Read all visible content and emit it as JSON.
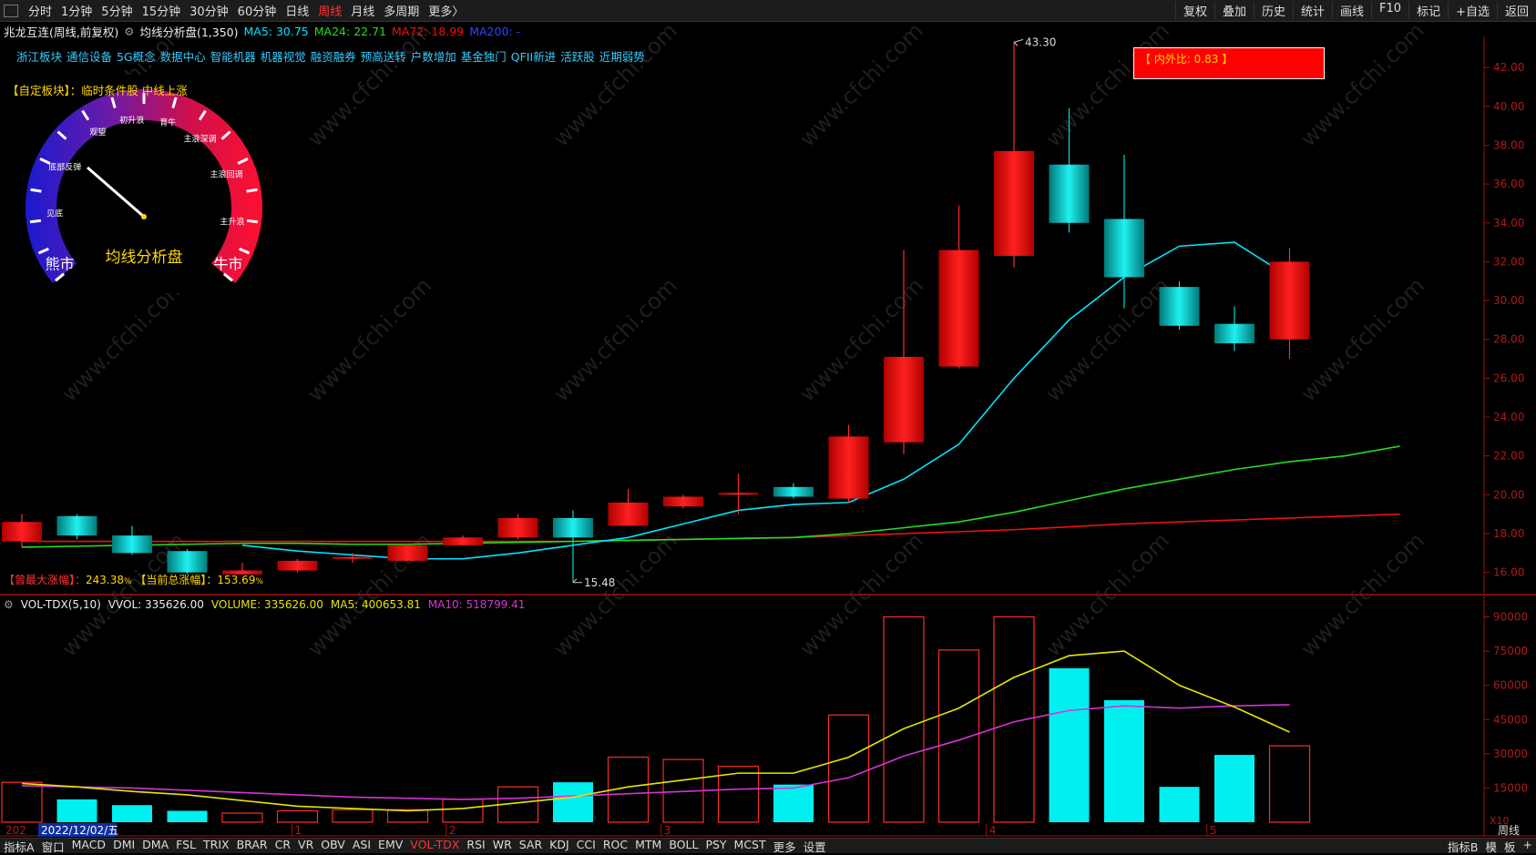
{
  "topbar": {
    "periods": [
      "分时",
      "1分钟",
      "5分钟",
      "15分钟",
      "30分钟",
      "60分钟",
      "日线",
      "周线",
      "月线",
      "多周期",
      "更多〉"
    ],
    "active_period": "周线",
    "right_buttons": [
      "复权",
      "叠加",
      "历史",
      "统计",
      "画线",
      "F10",
      "标记",
      "+自选",
      "返回"
    ]
  },
  "info": {
    "stock": "兆龙互连(周线,前复权)",
    "indicator": "均线分析盘(1,350)",
    "ma5": "MA5: 30.75",
    "ma24": "MA24: 22.71",
    "ma72": "MA72: 18.99",
    "ma200": "MA200: -"
  },
  "blocks": [
    "浙江板块",
    "通信设备",
    "5G概念",
    "数据中心",
    "智能机器",
    "机器视觉",
    "融资融券",
    "预高送转",
    "户数增加",
    "基金独门",
    "QFII新进",
    "活跃股",
    "近期弱势"
  ],
  "custom_block": {
    "label": "【自定板块】：",
    "value": "临时条件股 中线上涨"
  },
  "gauge": {
    "title": "均线分析盘",
    "labels": [
      "熊市",
      "见底",
      "底部反弹",
      "观望",
      "初升浪",
      "育牛",
      "主浪深调",
      "主浪回调",
      "主升浪",
      "牛市"
    ]
  },
  "ratio_box": {
    "label": "【 内外比: 0.83 】"
  },
  "stats": {
    "max_rise_label": "【曾最大涨幅】：",
    "max_rise": "243.38",
    "pct": "%",
    "current_rise_label": "【当前总涨幅】：",
    "current_rise": "153.69"
  },
  "markers": {
    "high": "43.30",
    "low": "15.48"
  },
  "volume_info": {
    "name": "VOL-TDX(5,10)",
    "vvol": "VVOL: 335626.00",
    "volume": "VOLUME: 335626.00",
    "ma5": "MA5: 400653.81",
    "ma10": "MA10: 518799.41"
  },
  "x_axis": {
    "date": "2022/12/02/五",
    "prefix": "202",
    "month_marks": [
      "1",
      "2",
      "3",
      "4",
      "5"
    ]
  },
  "price_axis": [
    "42.00",
    "40.00",
    "38.00",
    "36.00",
    "34.00",
    "32.00",
    "30.00",
    "28.00",
    "26.00",
    "24.00",
    "22.00",
    "20.00",
    "18.00",
    "16.00"
  ],
  "vol_axis": [
    "90000",
    "75000",
    "60000",
    "45000",
    "30000",
    "15000"
  ],
  "vol_unit": "X10",
  "period_corner": "周线",
  "bottombar": {
    "left": [
      "指标A",
      "窗口"
    ],
    "indicators": [
      "MACD",
      "DMI",
      "DMA",
      "FSL",
      "TRIX",
      "BRAR",
      "CR",
      "VR",
      "OBV",
      "ASI",
      "EMV",
      "VOL-TDX",
      "RSI",
      "WR",
      "SAR",
      "KDJ",
      "CCI",
      "ROC",
      "MTM",
      "BOLL",
      "PSY",
      "MCST",
      "更多",
      "设置"
    ],
    "active": "VOL-TDX",
    "right": [
      "指标B",
      "模",
      "板",
      "+"
    ]
  },
  "watermark": "www.cfchi.com",
  "colors": {
    "up": "#ff1a1a",
    "down": "#00e5e5",
    "ma5": "#00e5ff",
    "ma24": "#22dd22",
    "ma72": "#ee1111",
    "vol_ma5": "#e6e600",
    "vol_ma10": "#d633d6"
  },
  "chart_data": {
    "type": "candlestick",
    "price_range": [
      15,
      43.6
    ],
    "candles": [
      {
        "o": 17.6,
        "c": 18.6,
        "h": 19.0,
        "l": 17.3
      },
      {
        "o": 18.9,
        "c": 17.9,
        "h": 19.0,
        "l": 17.7
      },
      {
        "o": 17.9,
        "c": 17.0,
        "h": 18.4,
        "l": 16.9
      },
      {
        "o": 17.1,
        "c": 16.0,
        "h": 17.2,
        "l": 15.9
      },
      {
        "o": 15.9,
        "c": 16.1,
        "h": 16.5,
        "l": 15.9
      },
      {
        "o": 16.1,
        "c": 16.6,
        "h": 16.7,
        "l": 16.0
      },
      {
        "o": 16.7,
        "c": 16.8,
        "h": 17.0,
        "l": 16.5
      },
      {
        "o": 16.6,
        "c": 17.4,
        "h": 17.5,
        "l": 16.6
      },
      {
        "o": 17.4,
        "c": 17.8,
        "h": 17.9,
        "l": 17.4
      },
      {
        "o": 17.8,
        "c": 18.8,
        "h": 19.0,
        "l": 17.7
      },
      {
        "o": 18.8,
        "c": 17.8,
        "h": 19.2,
        "l": 15.5
      },
      {
        "o": 18.4,
        "c": 19.6,
        "h": 20.3,
        "l": 18.4
      },
      {
        "o": 19.4,
        "c": 19.9,
        "h": 20.0,
        "l": 19.3
      },
      {
        "o": 20.0,
        "c": 20.1,
        "h": 21.1,
        "l": 19.0
      },
      {
        "o": 20.4,
        "c": 19.9,
        "h": 20.6,
        "l": 19.8
      },
      {
        "o": 19.8,
        "c": 23.0,
        "h": 23.6,
        "l": 19.6
      },
      {
        "o": 22.7,
        "c": 27.1,
        "h": 32.6,
        "l": 22.1
      },
      {
        "o": 26.6,
        "c": 32.6,
        "h": 34.9,
        "l": 26.5
      },
      {
        "o": 32.3,
        "c": 37.7,
        "h": 43.3,
        "l": 31.7
      },
      {
        "o": 37.0,
        "c": 34.0,
        "h": 39.9,
        "l": 33.5
      },
      {
        "o": 34.2,
        "c": 31.2,
        "h": 37.5,
        "l": 29.6
      },
      {
        "o": 30.7,
        "c": 28.7,
        "h": 31.0,
        "l": 28.5
      },
      {
        "o": 28.8,
        "c": 27.8,
        "h": 29.7,
        "l": 27.4
      },
      {
        "o": 28.0,
        "c": 32.0,
        "h": 32.7,
        "l": 27.0
      }
    ],
    "ma5": [
      null,
      null,
      null,
      null,
      17.4,
      17.1,
      16.9,
      16.7,
      16.7,
      17.0,
      17.4,
      17.8,
      18.5,
      19.2,
      19.5,
      19.6,
      20.8,
      22.6,
      26.0,
      29.0,
      31.2,
      32.8,
      33.0,
      31.2
    ],
    "ma24": [
      17.3,
      17.35,
      17.4,
      17.45,
      17.5,
      17.5,
      17.45,
      17.45,
      17.5,
      17.55,
      17.6,
      17.65,
      17.7,
      17.75,
      17.8,
      18.0,
      18.3,
      18.6,
      19.1,
      19.7,
      20.3,
      20.8,
      21.3,
      21.7,
      22.0,
      22.5
    ],
    "ma72": [
      17.6,
      17.6,
      17.6,
      17.6,
      17.6,
      17.6,
      17.6,
      17.6,
      17.6,
      17.6,
      17.6,
      17.65,
      17.7,
      17.75,
      17.8,
      17.9,
      18.0,
      18.1,
      18.2,
      18.35,
      18.5,
      18.6,
      18.7,
      18.8,
      18.9,
      19.0
    ],
    "volume_range": [
      0,
      91000
    ],
    "volumes": [
      17500,
      10000,
      7500,
      5000,
      4000,
      5000,
      5500,
      5500,
      10000,
      15500,
      17500,
      28500,
      27500,
      24500,
      16500,
      47000,
      90000,
      75500,
      90000,
      67500,
      53500,
      15500,
      29500,
      33500
    ],
    "vol_ma5": [
      17000,
      15500,
      13500,
      12000,
      9500,
      7000,
      6000,
      5000,
      6000,
      8500,
      11000,
      15500,
      18500,
      21500,
      21500,
      28500,
      41000,
      50000,
      63500,
      73000,
      75000,
      60000,
      50500,
      39500
    ],
    "vol_ma10": [
      16000,
      15500,
      15000,
      14000,
      13000,
      12000,
      11000,
      10500,
      10000,
      10500,
      11500,
      12500,
      13500,
      14500,
      15000,
      19500,
      29000,
      36000,
      44000,
      49000,
      51000,
      50000,
      51000,
      51500
    ]
  }
}
